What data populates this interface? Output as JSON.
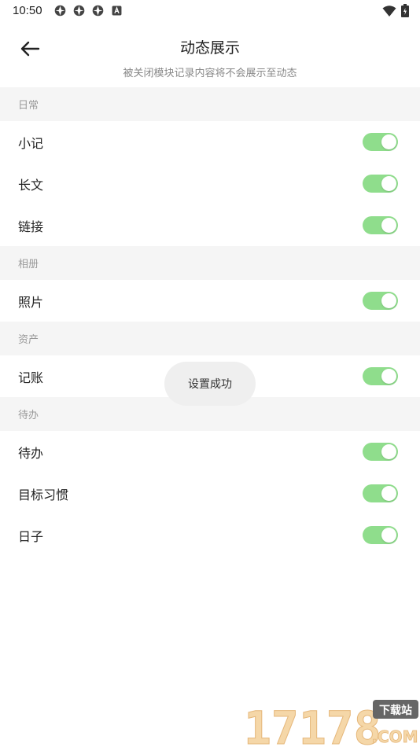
{
  "status_bar": {
    "time": "10:50",
    "icons": [
      "app-notification-icon",
      "app-notification-icon",
      "app-notification-icon",
      "a-badge-icon"
    ],
    "right_icons": [
      "wifi-icon",
      "battery-icon"
    ]
  },
  "header": {
    "title": "动态展示",
    "subtitle": "被关闭模块记录内容将不会展示至动态"
  },
  "sections": [
    {
      "title": "日常",
      "items": [
        {
          "label": "小记",
          "enabled": true
        },
        {
          "label": "长文",
          "enabled": true
        },
        {
          "label": "链接",
          "enabled": true
        }
      ]
    },
    {
      "title": "相册",
      "items": [
        {
          "label": "照片",
          "enabled": true
        }
      ]
    },
    {
      "title": "资产",
      "items": [
        {
          "label": "记账",
          "enabled": true
        }
      ]
    },
    {
      "title": "待办",
      "items": [
        {
          "label": "待办",
          "enabled": true
        },
        {
          "label": "目标习惯",
          "enabled": true
        },
        {
          "label": "日子",
          "enabled": true
        }
      ]
    }
  ],
  "toast": {
    "message": "设置成功"
  },
  "watermark": {
    "number": "17178",
    "top_text": "下载站",
    "bottom_text": ".COM"
  },
  "colors": {
    "toggle_on": "#8fdd8c",
    "section_bg": "#f5f5f5",
    "text_primary": "#222222",
    "text_secondary": "#999999"
  }
}
